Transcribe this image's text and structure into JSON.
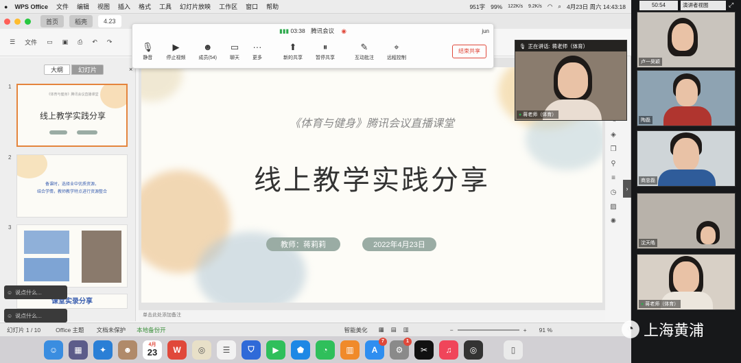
{
  "menubar": {
    "app": "WPS Office",
    "menus": [
      "文件",
      "编辑",
      "视图",
      "插入",
      "格式",
      "工具",
      "幻灯片放映",
      "工作区",
      "窗口",
      "帮助"
    ],
    "chars": "951字",
    "battery": "99%",
    "net_up": "122K/s",
    "net_down": "9.2K/s",
    "datetime": "4月23日 周六  14:43:18"
  },
  "presenter_view": {
    "time": "50:54",
    "label": "演讲者视图"
  },
  "tabs": {
    "home": "首页",
    "docer": "稻壳",
    "file": "4.23"
  },
  "toolbar": {
    "file_label": "文件"
  },
  "meeting": {
    "time": "03:38",
    "app": "腾讯会议",
    "user": "jun",
    "buttons": [
      {
        "icon": "mic-icon",
        "label": "静音"
      },
      {
        "icon": "camera-icon",
        "label": "停止视频"
      },
      {
        "icon": "people-icon",
        "label": "成员(54)"
      },
      {
        "icon": "chat-icon",
        "label": "聊天"
      },
      {
        "icon": "more-icon",
        "label": "更多"
      },
      {
        "icon": "share-icon",
        "label": "新的共享"
      },
      {
        "icon": "pause-icon",
        "label": "暂停共享"
      },
      {
        "icon": "annotate-icon",
        "label": "互动批注"
      },
      {
        "icon": "remote-icon",
        "label": "远程控制"
      }
    ],
    "end_share": "结束共享"
  },
  "speaking": {
    "prefix": "正在讲话:",
    "name": "蒋老师（体育）"
  },
  "panel": {
    "tab_outline": "大纲",
    "tab_slides": "幻灯片",
    "slide2_text": [
      "备课时，选择业中优质资源，",
      "结合学情，教师教学特点进行资源整合"
    ],
    "slide1_sub": "《体育与健身》腾讯会议直播课堂",
    "slide1_title": "线上教学实践分享",
    "slide4_title": "课堂实录分享",
    "slide_numbers": [
      "1",
      "2",
      "3"
    ]
  },
  "slide": {
    "subtitle": "《体育与健身》腾讯会议直播课堂",
    "title": "线上教学实践分享",
    "teacher": "教师：蒋莉莉",
    "date": "2022年4月23日"
  },
  "notes": "单击此处添加备注",
  "chat_placeholder": "说点什么...",
  "status": {
    "slide": "幻灯片 1 / 10",
    "theme": "Office 主题",
    "protect": "文档未保护",
    "backup": "本地备份开",
    "beautify": "智能美化",
    "zoom": "91 %"
  },
  "participants": [
    {
      "name": "卢一昊颖"
    },
    {
      "name": "陶磊"
    },
    {
      "name": "商忠磊"
    },
    {
      "name": "沈天皓"
    },
    {
      "name": "蒋老师（体育）"
    }
  ],
  "speaker_tile": "蒋老师（体育）",
  "dock": {
    "calendar_month": "4月",
    "calendar_day": "23",
    "badge_app_store": "7",
    "badge_settings": "1"
  },
  "watermark": "上海黄浦",
  "colors": {
    "accent": "#e4843c",
    "pill": "#9aaca4",
    "end_share": "#e0483a"
  }
}
